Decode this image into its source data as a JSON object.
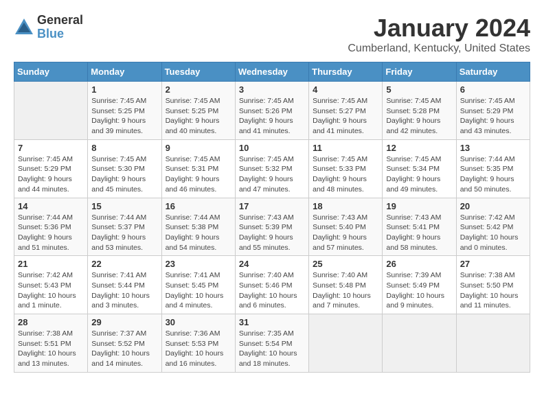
{
  "logo": {
    "general": "General",
    "blue": "Blue"
  },
  "title": "January 2024",
  "subtitle": "Cumberland, Kentucky, United States",
  "weekdays": [
    "Sunday",
    "Monday",
    "Tuesday",
    "Wednesday",
    "Thursday",
    "Friday",
    "Saturday"
  ],
  "weeks": [
    [
      {
        "day": "",
        "info": ""
      },
      {
        "day": "1",
        "info": "Sunrise: 7:45 AM\nSunset: 5:25 PM\nDaylight: 9 hours\nand 39 minutes."
      },
      {
        "day": "2",
        "info": "Sunrise: 7:45 AM\nSunset: 5:25 PM\nDaylight: 9 hours\nand 40 minutes."
      },
      {
        "day": "3",
        "info": "Sunrise: 7:45 AM\nSunset: 5:26 PM\nDaylight: 9 hours\nand 41 minutes."
      },
      {
        "day": "4",
        "info": "Sunrise: 7:45 AM\nSunset: 5:27 PM\nDaylight: 9 hours\nand 41 minutes."
      },
      {
        "day": "5",
        "info": "Sunrise: 7:45 AM\nSunset: 5:28 PM\nDaylight: 9 hours\nand 42 minutes."
      },
      {
        "day": "6",
        "info": "Sunrise: 7:45 AM\nSunset: 5:29 PM\nDaylight: 9 hours\nand 43 minutes."
      }
    ],
    [
      {
        "day": "7",
        "info": "Sunrise: 7:45 AM\nSunset: 5:29 PM\nDaylight: 9 hours\nand 44 minutes."
      },
      {
        "day": "8",
        "info": "Sunrise: 7:45 AM\nSunset: 5:30 PM\nDaylight: 9 hours\nand 45 minutes."
      },
      {
        "day": "9",
        "info": "Sunrise: 7:45 AM\nSunset: 5:31 PM\nDaylight: 9 hours\nand 46 minutes."
      },
      {
        "day": "10",
        "info": "Sunrise: 7:45 AM\nSunset: 5:32 PM\nDaylight: 9 hours\nand 47 minutes."
      },
      {
        "day": "11",
        "info": "Sunrise: 7:45 AM\nSunset: 5:33 PM\nDaylight: 9 hours\nand 48 minutes."
      },
      {
        "day": "12",
        "info": "Sunrise: 7:45 AM\nSunset: 5:34 PM\nDaylight: 9 hours\nand 49 minutes."
      },
      {
        "day": "13",
        "info": "Sunrise: 7:44 AM\nSunset: 5:35 PM\nDaylight: 9 hours\nand 50 minutes."
      }
    ],
    [
      {
        "day": "14",
        "info": "Sunrise: 7:44 AM\nSunset: 5:36 PM\nDaylight: 9 hours\nand 51 minutes."
      },
      {
        "day": "15",
        "info": "Sunrise: 7:44 AM\nSunset: 5:37 PM\nDaylight: 9 hours\nand 53 minutes."
      },
      {
        "day": "16",
        "info": "Sunrise: 7:44 AM\nSunset: 5:38 PM\nDaylight: 9 hours\nand 54 minutes."
      },
      {
        "day": "17",
        "info": "Sunrise: 7:43 AM\nSunset: 5:39 PM\nDaylight: 9 hours\nand 55 minutes."
      },
      {
        "day": "18",
        "info": "Sunrise: 7:43 AM\nSunset: 5:40 PM\nDaylight: 9 hours\nand 57 minutes."
      },
      {
        "day": "19",
        "info": "Sunrise: 7:43 AM\nSunset: 5:41 PM\nDaylight: 9 hours\nand 58 minutes."
      },
      {
        "day": "20",
        "info": "Sunrise: 7:42 AM\nSunset: 5:42 PM\nDaylight: 10 hours\nand 0 minutes."
      }
    ],
    [
      {
        "day": "21",
        "info": "Sunrise: 7:42 AM\nSunset: 5:43 PM\nDaylight: 10 hours\nand 1 minute."
      },
      {
        "day": "22",
        "info": "Sunrise: 7:41 AM\nSunset: 5:44 PM\nDaylight: 10 hours\nand 3 minutes."
      },
      {
        "day": "23",
        "info": "Sunrise: 7:41 AM\nSunset: 5:45 PM\nDaylight: 10 hours\nand 4 minutes."
      },
      {
        "day": "24",
        "info": "Sunrise: 7:40 AM\nSunset: 5:46 PM\nDaylight: 10 hours\nand 6 minutes."
      },
      {
        "day": "25",
        "info": "Sunrise: 7:40 AM\nSunset: 5:48 PM\nDaylight: 10 hours\nand 7 minutes."
      },
      {
        "day": "26",
        "info": "Sunrise: 7:39 AM\nSunset: 5:49 PM\nDaylight: 10 hours\nand 9 minutes."
      },
      {
        "day": "27",
        "info": "Sunrise: 7:38 AM\nSunset: 5:50 PM\nDaylight: 10 hours\nand 11 minutes."
      }
    ],
    [
      {
        "day": "28",
        "info": "Sunrise: 7:38 AM\nSunset: 5:51 PM\nDaylight: 10 hours\nand 13 minutes."
      },
      {
        "day": "29",
        "info": "Sunrise: 7:37 AM\nSunset: 5:52 PM\nDaylight: 10 hours\nand 14 minutes."
      },
      {
        "day": "30",
        "info": "Sunrise: 7:36 AM\nSunset: 5:53 PM\nDaylight: 10 hours\nand 16 minutes."
      },
      {
        "day": "31",
        "info": "Sunrise: 7:35 AM\nSunset: 5:54 PM\nDaylight: 10 hours\nand 18 minutes."
      },
      {
        "day": "",
        "info": ""
      },
      {
        "day": "",
        "info": ""
      },
      {
        "day": "",
        "info": ""
      }
    ]
  ]
}
